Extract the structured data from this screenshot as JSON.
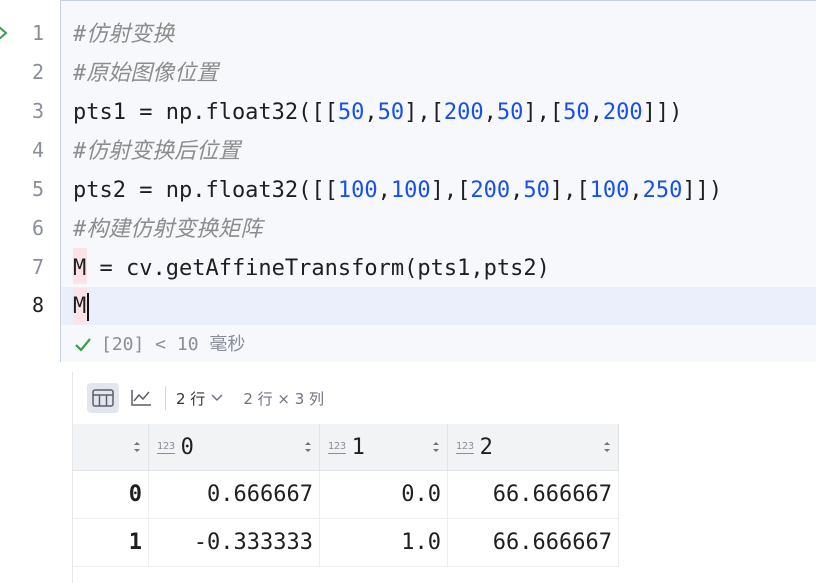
{
  "gutter": {
    "line_numbers": [
      "1",
      "2",
      "3",
      "4",
      "5",
      "6",
      "7",
      "8"
    ]
  },
  "code": {
    "l1": "#仿射变换",
    "l2": "#原始图像位置",
    "l3": {
      "pre": "pts1 = np.float32([[",
      "n1": "50",
      "c1": ",",
      "n2": "50",
      "c2": "],[",
      "n3": "200",
      "c3": ",",
      "n4": "50",
      "c4": "],[",
      "n5": "50",
      "c5": ",",
      "n6": "200",
      "post": "]])"
    },
    "l4": "#仿射变换后位置",
    "l5": {
      "pre": "pts2 = np.float32([[",
      "n1": "100",
      "c1": ",",
      "n2": "100",
      "c2": "],[",
      "n3": "200",
      "c3": ",",
      "n4": "50",
      "c4": "],[",
      "n5": "100",
      "c5": ",",
      "n6": "250",
      "post": "]])"
    },
    "l6": "#构建仿射变换矩阵",
    "l7": "M = cv.getAffineTransform(pts1,pts2)",
    "l8": "M"
  },
  "status": {
    "text": "[20] < 10 毫秒",
    "icon": "check-icon",
    "color": "#3c9a4b"
  },
  "output": {
    "toolbar": {
      "rows_label": "2 行",
      "shape": "2 行 × 3 列"
    },
    "table": {
      "type_badge": "123",
      "columns": [
        "0",
        "1",
        "2"
      ],
      "rows": [
        {
          "index": "0",
          "values": [
            "0.666667",
            "0.0",
            "66.666667"
          ]
        },
        {
          "index": "1",
          "values": [
            "-0.333333",
            "1.0",
            "66.666667"
          ]
        }
      ]
    }
  }
}
